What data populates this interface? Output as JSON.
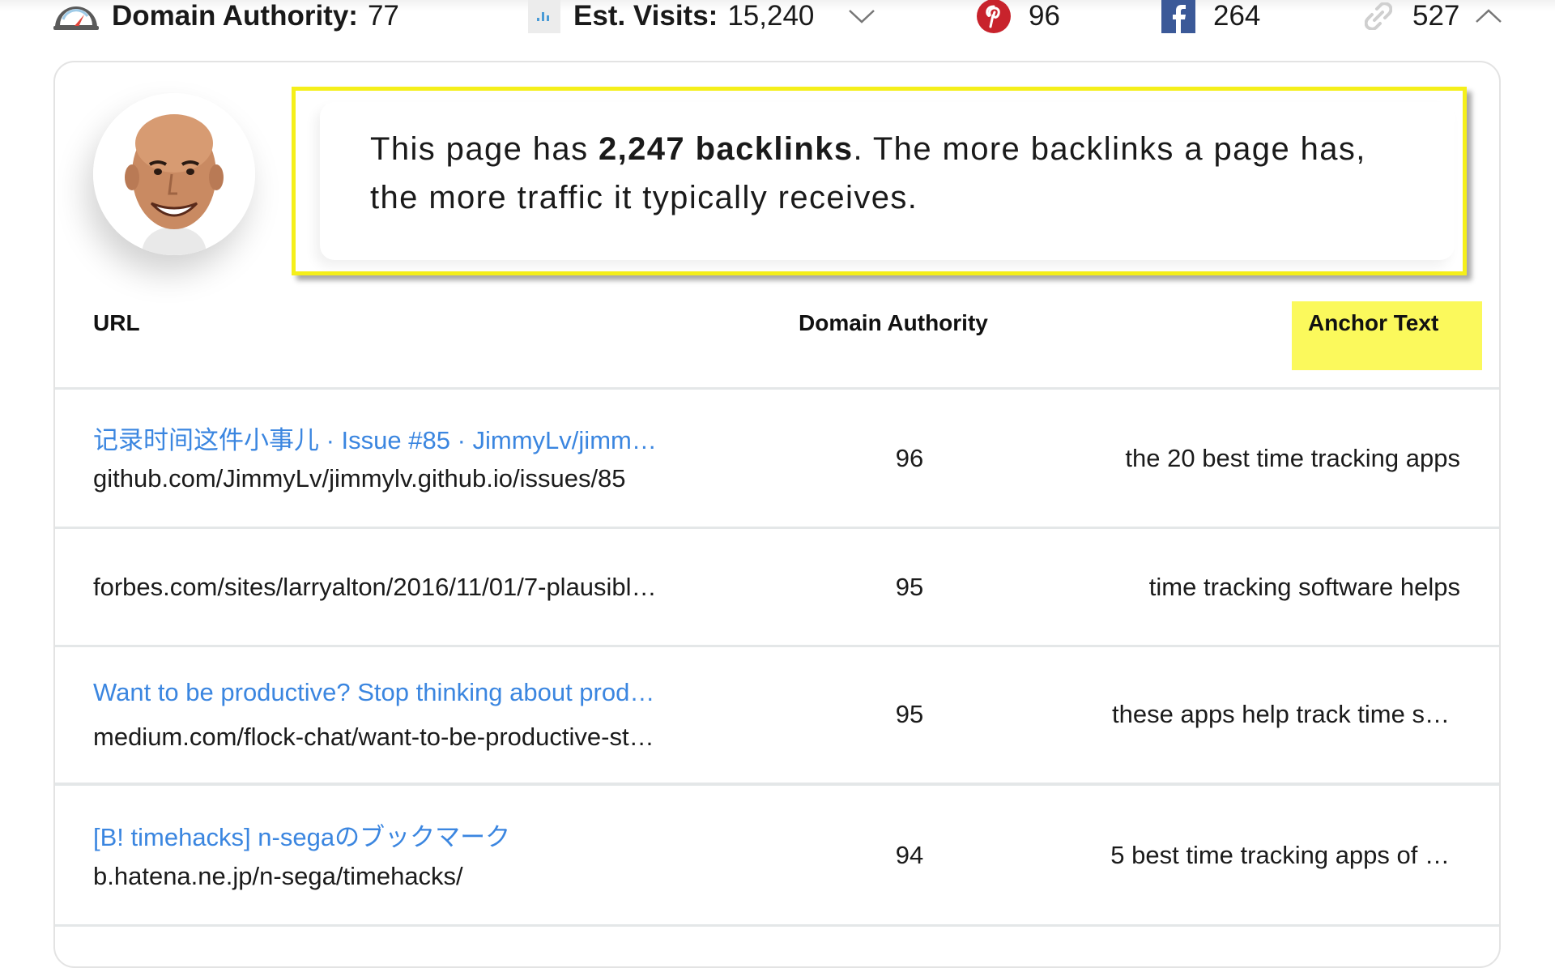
{
  "topbar": {
    "domain_authority": {
      "icon": "gauge-icon",
      "label": "Domain Authority:",
      "value": "77"
    },
    "est_visits": {
      "icon": "bar-chart-icon",
      "label": "Est. Visits:",
      "value": "15,240",
      "toggle_icon": "chevron-down-icon"
    },
    "pinterest": {
      "icon": "pinterest-icon",
      "value": "96",
      "color": "#c8232c"
    },
    "facebook": {
      "icon": "facebook-icon",
      "value": "264",
      "color": "#3b5998"
    },
    "links": {
      "icon": "link-icon",
      "value": "527"
    },
    "collapse_icon": "chevron-up-icon"
  },
  "callout": {
    "prefix": "This page has ",
    "highlight": "2,247 backlinks",
    "suffix": ". The more backlinks a page has, the more traffic it typically receives.",
    "border_color": "#f5ef1a"
  },
  "table": {
    "headers": {
      "url": "URL",
      "domain_authority": "Domain Authority",
      "anchor_text": "Anchor Text"
    },
    "highlight_color": "#fbf95c",
    "rows": [
      {
        "title": "记录时间这件小事儿 · Issue #85 · JimmyLv/jimm…",
        "url": "github.com/JimmyLv/jimmylv.github.io/issues/85",
        "da": "96",
        "anchor": "the 20 best time tracking apps"
      },
      {
        "title": "",
        "url": "forbes.com/sites/larryalton/2016/11/01/7-plausibl…",
        "da": "95",
        "anchor": "time tracking software helps"
      },
      {
        "title": "Want to be productive? Stop thinking about prod…",
        "url": "medium.com/flock-chat/want-to-be-productive-st…",
        "da": "95",
        "anchor": "these apps help track time s…"
      },
      {
        "title": "[B! timehacks] n-segaのブックマーク",
        "url": "b.hatena.ne.jp/n-sega/timehacks/",
        "da": "94",
        "anchor": "5 best time tracking apps of …"
      }
    ]
  }
}
